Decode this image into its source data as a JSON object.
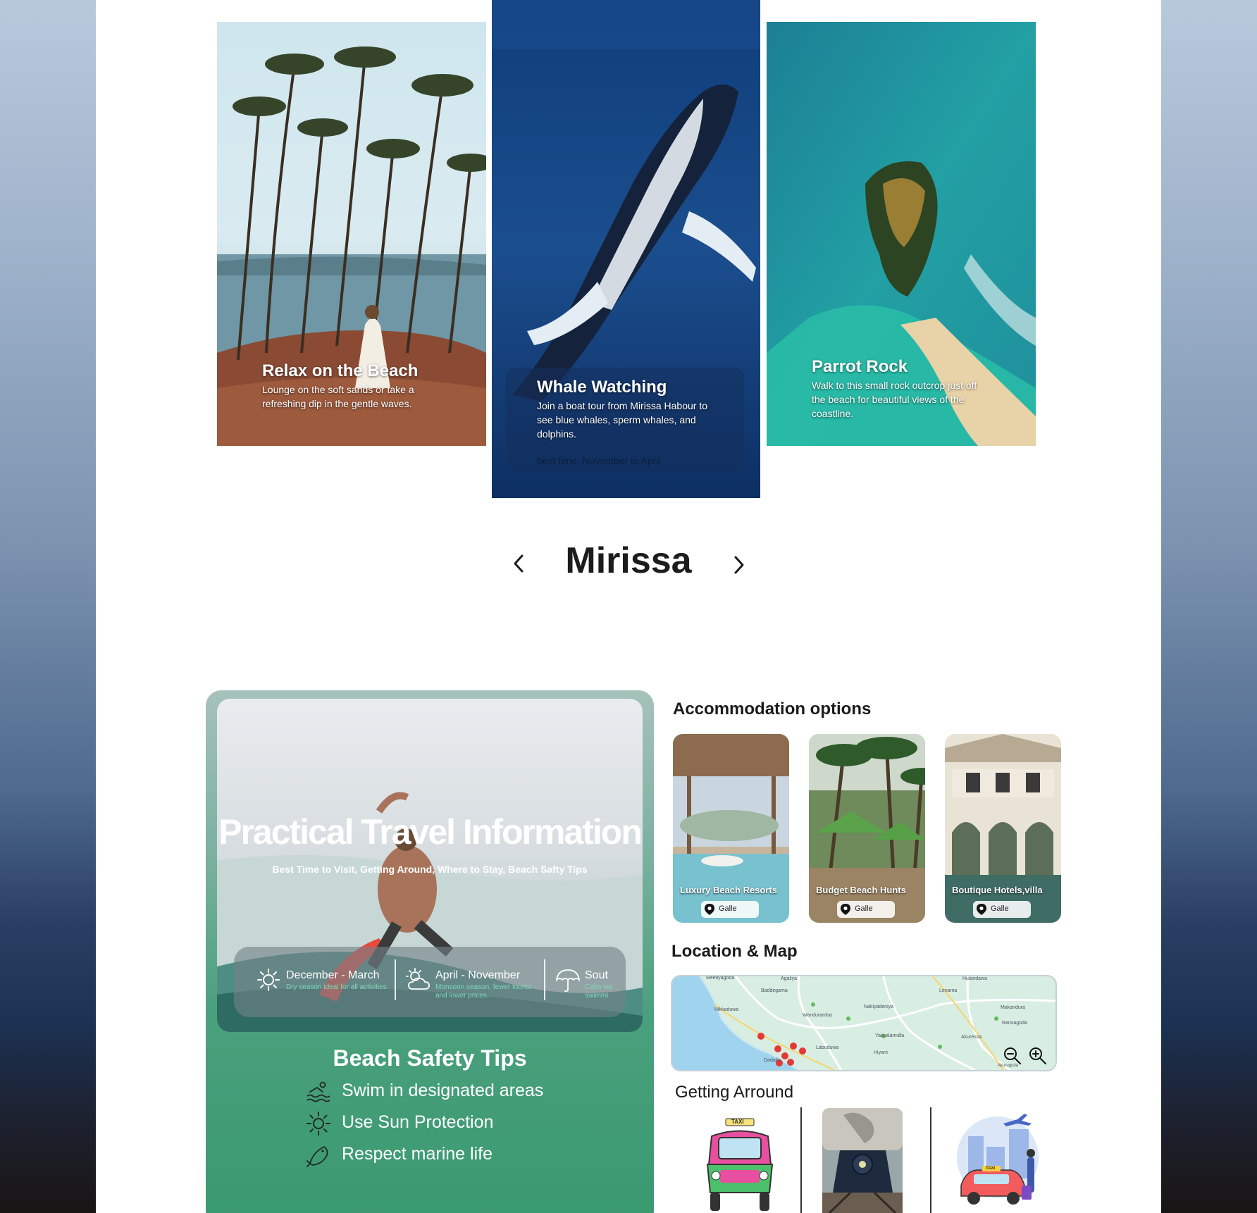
{
  "attractions": [
    {
      "title": "Relax on the Beach",
      "description": "Lounge on the soft sands or take a refreshing dip in the gentle waves."
    },
    {
      "title": "Whale Watching",
      "description": "Join a boat tour from Mirissa Habour to see blue whales, sperm whales, and dolphins.",
      "best_time": "best time: November to April"
    },
    {
      "title": "Parrot Rock",
      "description": "Walk to this small rock outcrop just off the beach for beautiful views of the coastline."
    }
  ],
  "carousel": {
    "title": "Mirissa",
    "prev_icon": "chevron-left-icon",
    "next_icon": "chevron-right-icon"
  },
  "practical": {
    "heading": "Practical Travel Information",
    "subheading": "Best Time to Visit, Getting Around, Where to Stay, Beach Safty Tips",
    "seasons": [
      {
        "title": "December - March",
        "description": "Dry season ideal for all activities",
        "icon": "sun-icon"
      },
      {
        "title": "April - November",
        "description": "Monsoon season, fewer tourist\nand lower prices.",
        "icon": "cloud-sun-icon"
      },
      {
        "title": "Sout",
        "description": "Calm wa\nswimmi",
        "icon": "umbrella-icon"
      }
    ],
    "safety_title": "Beach Safety Tips",
    "tips": [
      {
        "label": "Swim in designated areas",
        "icon": "swim-icon"
      },
      {
        "label": "Use Sun Protection",
        "icon": "sun-icon"
      },
      {
        "label": "Respect marine life",
        "icon": "fish-icon"
      }
    ]
  },
  "accommodation": {
    "title": "Accommodation options",
    "items": [
      {
        "label": "Luxury Beach Resorts",
        "location": "Galle"
      },
      {
        "label": "Budget Beach Hunts",
        "location": "Galle"
      },
      {
        "label": "Boutique Hotels,villa",
        "location": "Galle"
      }
    ]
  },
  "map": {
    "title": "Location & Map",
    "places": [
      "Meetiyagoda",
      "Agaliya",
      "Baddegama",
      "Hikkaduwa",
      "Wanduramba",
      "Nakiyadeniya",
      "Lenama",
      "Hulandawa",
      "Makandura",
      "Ransagoda",
      "Yakkalamulla",
      "Akuressa",
      "Labuduwa",
      "Hiyare",
      "Dadalla",
      "Akuressa",
      "Akurugoda"
    ],
    "zoom_out_icon": "zoom-out-icon",
    "zoom_in_icon": "zoom-in-icon"
  },
  "getting_around": {
    "title": "Getting Arround",
    "items": [
      {
        "name": "tuk-tuk",
        "sign": "TAXI"
      },
      {
        "name": "train"
      },
      {
        "name": "taxi",
        "sign": "TAXI"
      }
    ]
  },
  "colors": {
    "accent_green": "#39996f",
    "heading_dark": "#1c1c1c",
    "whale_blue": "#123a6f"
  }
}
